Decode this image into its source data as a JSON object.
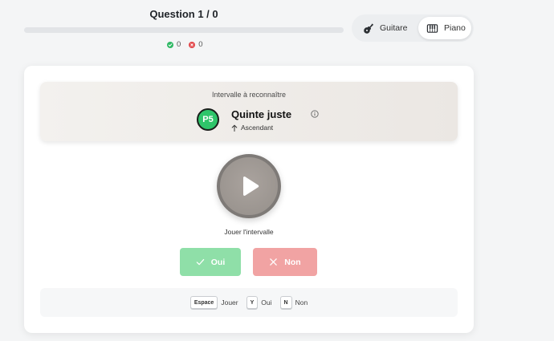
{
  "header": {
    "question_label": "Question 1 / 0",
    "progress_percent": 0,
    "score_correct": "0",
    "score_wrong": "0"
  },
  "instruments": [
    {
      "label": "Guitare",
      "icon": "guitar-icon",
      "selected": false
    },
    {
      "label": "Piano",
      "icon": "piano-icon",
      "selected": true
    }
  ],
  "interval": {
    "caption": "Intervalle à reconnaître",
    "badge": "P5",
    "name": "Quinte juste",
    "direction": "Ascendant"
  },
  "play": {
    "label": "Jouer l'intervalle"
  },
  "answers": {
    "yes_label": "Oui",
    "no_label": "Non"
  },
  "shortcuts": [
    {
      "key": "Espace",
      "action": "Jouer"
    },
    {
      "key": "Y",
      "action": "Oui"
    },
    {
      "key": "N",
      "action": "Non"
    }
  ],
  "colors": {
    "correct": "#2fb864",
    "wrong": "#e2484b",
    "yes_button": "#8fdfa8",
    "no_button": "#f1a3a3",
    "badge": "#2fc56a"
  }
}
